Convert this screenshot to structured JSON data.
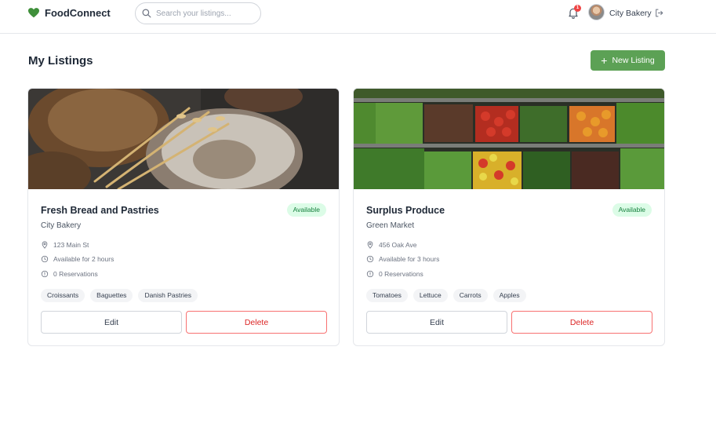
{
  "app": {
    "name": "FoodConnect",
    "brand_color": "#3f8f3a"
  },
  "search": {
    "placeholder": "Search your listings...",
    "value": ""
  },
  "header": {
    "notification_count": "1",
    "user_name": "City Bakery"
  },
  "page": {
    "title": "My Listings",
    "new_listing_label": "New Listing"
  },
  "listings": [
    {
      "title": "Fresh Bread and Pastries",
      "organization": "City Bakery",
      "status": "Available",
      "address": "123 Main St",
      "availability": "Available for 2 hours",
      "reservations": "0 Reservations",
      "tags": [
        "Croissants",
        "Baguettes",
        "Danish Pastries"
      ],
      "edit_label": "Edit",
      "delete_label": "Delete"
    },
    {
      "title": "Surplus Produce",
      "organization": "Green Market",
      "status": "Available",
      "address": "456 Oak Ave",
      "availability": "Available for 3 hours",
      "reservations": "0 Reservations",
      "tags": [
        "Tomatoes",
        "Lettuce",
        "Carrots",
        "Apples"
      ],
      "edit_label": "Edit",
      "delete_label": "Delete"
    }
  ]
}
